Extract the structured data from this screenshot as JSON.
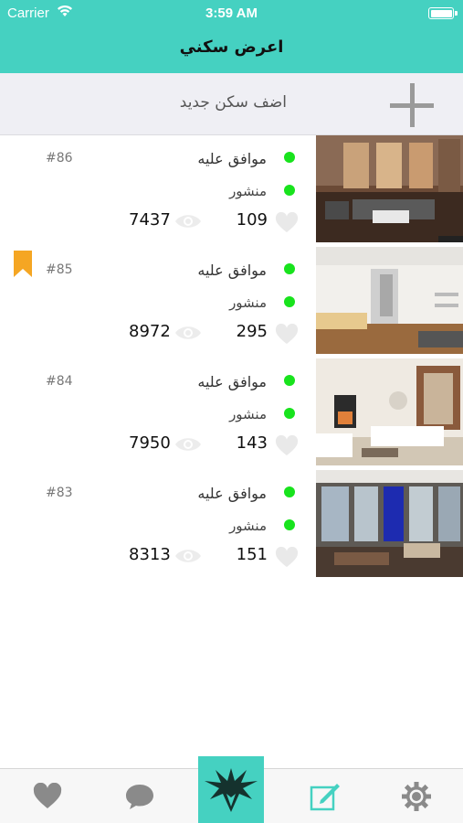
{
  "status": {
    "carrier": "Carrier",
    "time": "3:59 AM"
  },
  "nav": {
    "title": "اعرض سكني"
  },
  "add": {
    "label": "اضف سكن جديد"
  },
  "colors": {
    "accent": "#45d1c1",
    "status_dot": "#18e31d",
    "bookmark": "#f5a623"
  },
  "listings": [
    {
      "number": "#86",
      "approval": "موافق عليه",
      "publish": "منشور",
      "likes": "109",
      "views": "7437",
      "bookmarked": false
    },
    {
      "number": "#85",
      "approval": "موافق عليه",
      "publish": "منشور",
      "likes": "295",
      "views": "8972",
      "bookmarked": true
    },
    {
      "number": "#84",
      "approval": "موافق عليه",
      "publish": "منشور",
      "likes": "143",
      "views": "7950",
      "bookmarked": false
    },
    {
      "number": "#83",
      "approval": "موافق عليه",
      "publish": "منشور",
      "likes": "151",
      "views": "8313",
      "bookmarked": false
    }
  ],
  "tabs": [
    {
      "icon": "heart-icon"
    },
    {
      "icon": "chat-bubble-icon"
    },
    {
      "icon": "app-logo-icon"
    },
    {
      "icon": "edit-icon"
    },
    {
      "icon": "settings-gear-icon"
    }
  ]
}
